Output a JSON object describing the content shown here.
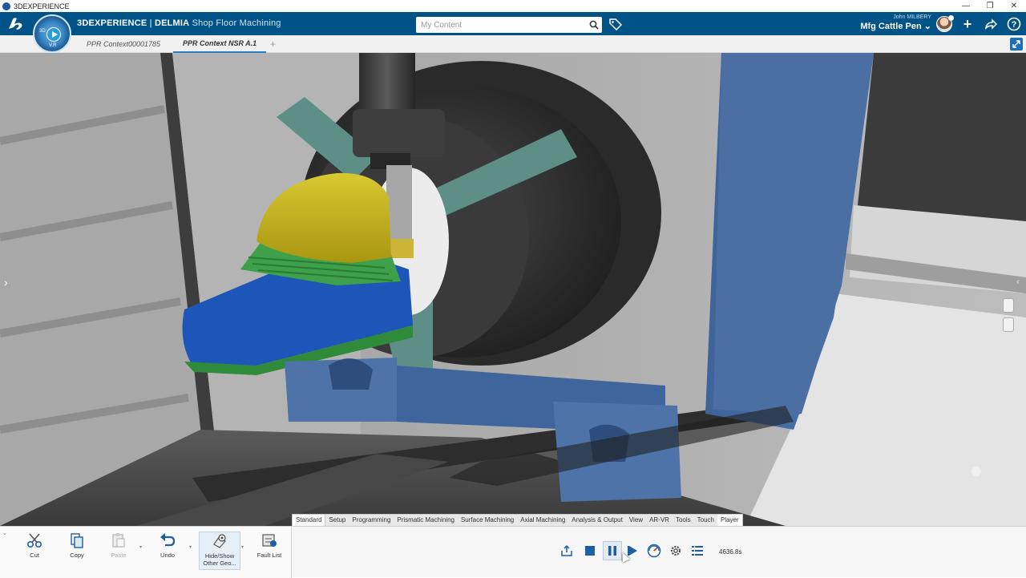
{
  "window": {
    "title": "3DEXPERIENCE",
    "minimize": "—",
    "restore": "❐",
    "close": "✕"
  },
  "header": {
    "brand": "3DEXPERIENCE",
    "separator": " | ",
    "product": "DELMIA",
    "app": "Shop Floor Machining",
    "compass_labels": [
      "3D",
      "V.R"
    ],
    "search_placeholder": "My Content",
    "user_name": "John MILBERY",
    "workspace": "Mfg Cattle Pen",
    "icons": [
      "search-icon",
      "tag-icon",
      "add-icon",
      "share-icon",
      "help-icon"
    ],
    "add_label": "+",
    "help_label": "?"
  },
  "tabs": [
    {
      "label": "PPR Context00001785",
      "active": false
    },
    {
      "label": "PPR Context NSR A.1",
      "active": true
    }
  ],
  "tab_add": "+",
  "section_tabs": [
    "Standard",
    "Setup",
    "Programming",
    "Prismatic Machining",
    "Surface Machining",
    "Axial Machining",
    "Analysis & Output",
    "View",
    "AR-VR",
    "Tools",
    "Touch",
    "Player"
  ],
  "commands": [
    {
      "label": "Cut",
      "icon": "scissors-icon",
      "enabled": true
    },
    {
      "label": "Copy",
      "icon": "copy-icon",
      "enabled": true
    },
    {
      "label": "Paste",
      "icon": "paste-icon",
      "enabled": false
    },
    {
      "label": "Undo",
      "icon": "undo-icon",
      "enabled": true
    },
    {
      "label": "Hide/Show Other Geo...",
      "icon": "hide-show-icon",
      "enabled": true
    },
    {
      "label": "Fault List",
      "icon": "fault-list-icon",
      "enabled": true
    }
  ],
  "player": {
    "controls": [
      "export-icon",
      "stop-icon",
      "pause-icon",
      "step-forward-icon",
      "speed-icon",
      "settings-icon",
      "list-icon"
    ],
    "time": "4636.8s"
  },
  "colors": {
    "header": "#005386",
    "machine_blue": "#4a6c9e",
    "part_yellow": "#c8b81c",
    "part_green": "#3ea04a",
    "part_blue": "#1d55b8",
    "fixture": "#5d8f86"
  }
}
